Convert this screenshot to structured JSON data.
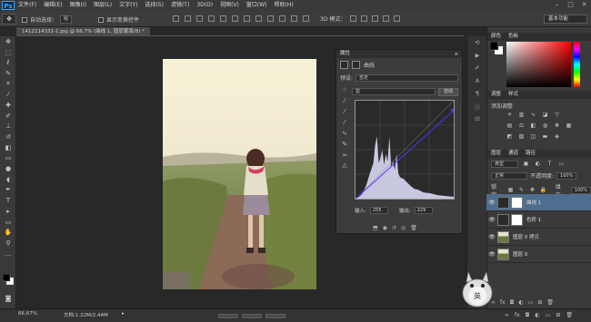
{
  "app": {
    "logo": "Ps"
  },
  "menu": [
    "文件(F)",
    "编辑(E)",
    "图像(I)",
    "图层(L)",
    "文字(Y)",
    "选择(S)",
    "滤镜(T)",
    "3D(D)",
    "视图(V)",
    "窗口(W)",
    "帮助(H)"
  ],
  "window_controls": [
    "–",
    "□",
    "✕"
  ],
  "options_bar": {
    "auto_select_label": "自动选择：",
    "auto_select_value": "组",
    "show_transform_label": "显示变换控件",
    "mode_label": "3D 模式："
  },
  "workspace": "基本功能",
  "document": {
    "tab_title": "1412214331-1.jpg @ 66.7% (曲线 1, 图层蒙版/8) *"
  },
  "status": {
    "zoom": "66.67%",
    "doc_info": "文档:1.22M/2.44M"
  },
  "properties": {
    "tab_label": "属性",
    "adjustment_name": "曲线",
    "preset_label": "预设:",
    "preset_value": "自定",
    "channel_value": "蓝",
    "auto_label": "自动",
    "input_label": "输入:",
    "input_value": "255",
    "output_label": "输出:",
    "output_value": "229"
  },
  "panels": {
    "color_tabs": [
      "颜色",
      "色板"
    ],
    "adjust_tabs": [
      "调整",
      "样式"
    ],
    "adjust_title": "添加调整",
    "layer_tabs": [
      "图层",
      "通道",
      "路径"
    ],
    "kind_label": "类型",
    "blend_mode": "正常",
    "opacity_label": "不透明度:",
    "opacity_value": "100%",
    "lock_label": "锁定:",
    "fill_label": "填充:",
    "fill_value": "100%"
  },
  "layers": [
    {
      "name": "曲线 1",
      "active": true
    },
    {
      "name": "色阶 1",
      "active": false
    },
    {
      "name": "图层 0 拷贝",
      "active": false
    },
    {
      "name": "图层 0",
      "active": false
    }
  ],
  "mascot_label": "英",
  "colors": {
    "accent": "#31a8ff",
    "selected_layer": "#4f6d8e",
    "curve_line": "#3a3aff"
  }
}
